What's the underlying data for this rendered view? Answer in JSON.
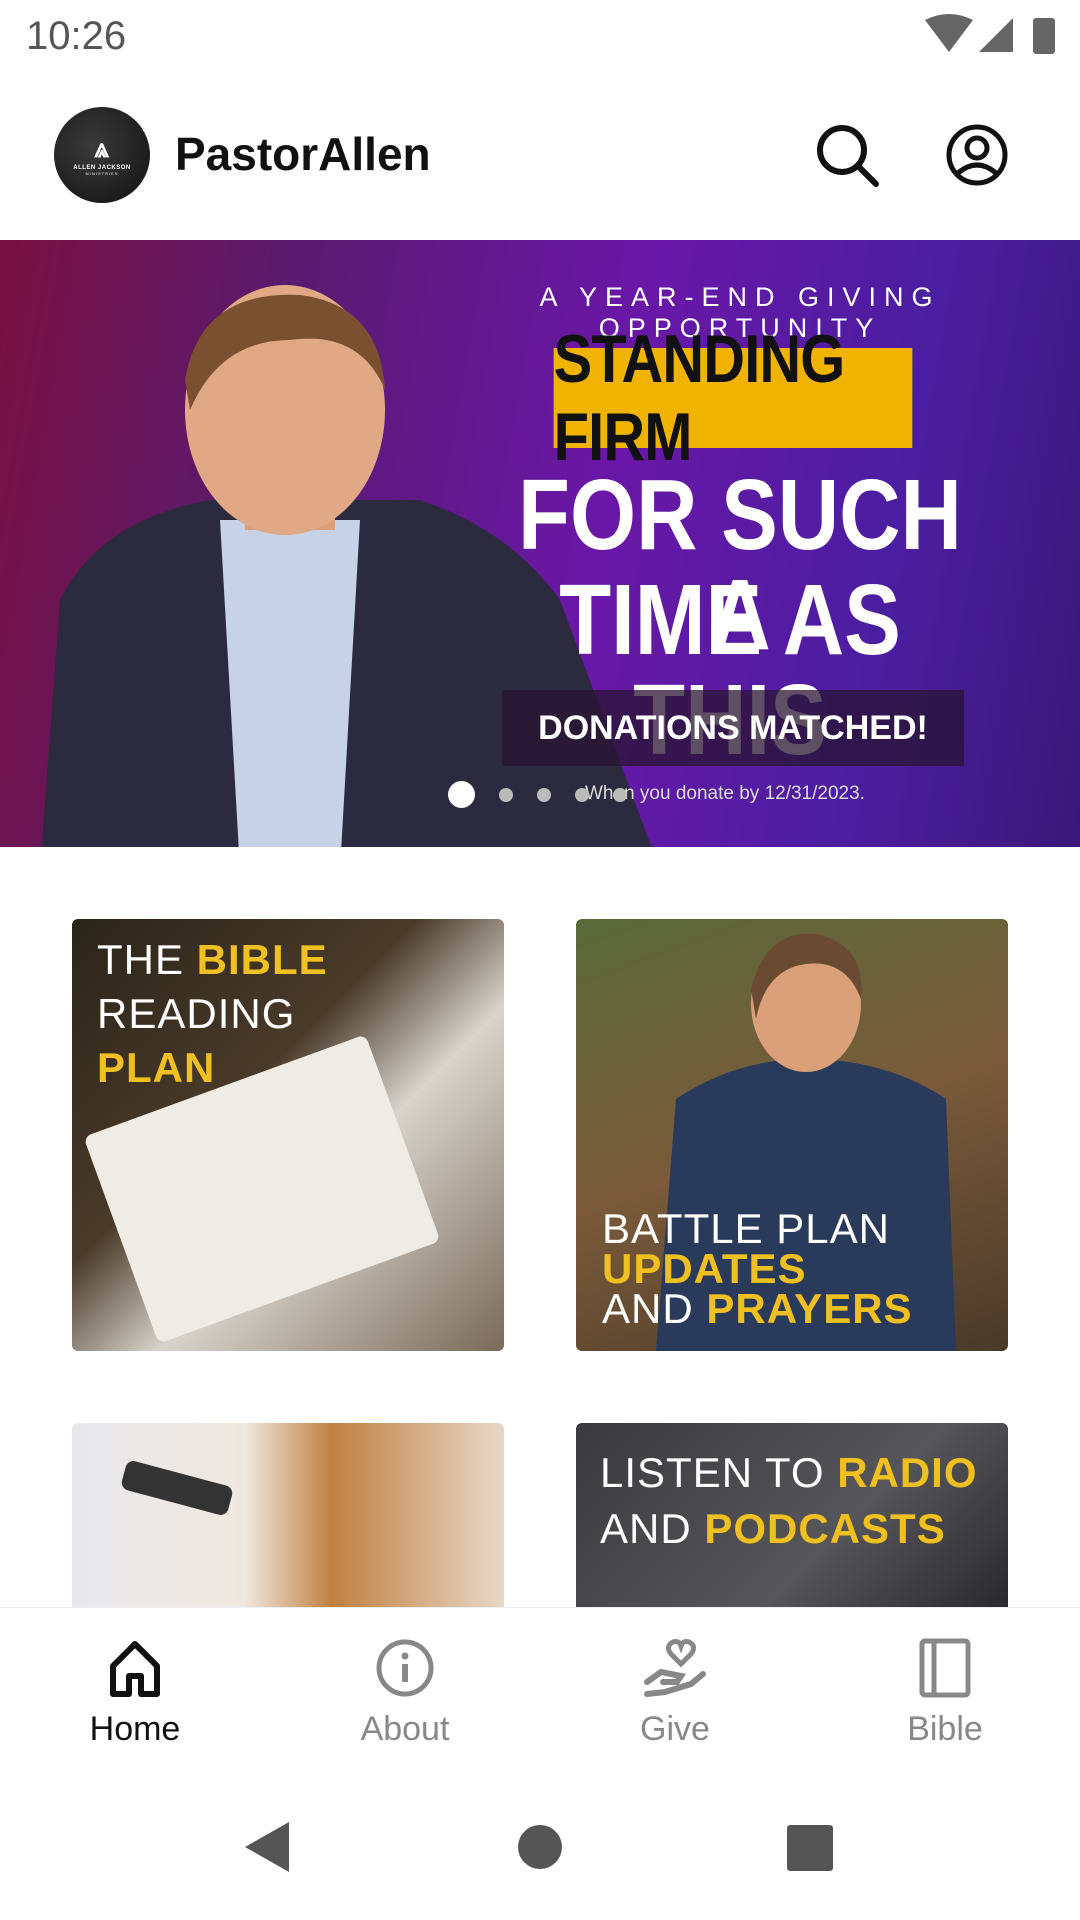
{
  "status_bar": {
    "time": "10:26"
  },
  "header": {
    "logo_text": "ALLEN JACKSON",
    "logo_subtext": "MINISTRIES",
    "title": "PastorAllen"
  },
  "banner": {
    "kicker": "A YEAR-END GIVING OPPORTUNITY",
    "highlight": "STANDING FIRM",
    "headline_1": "FOR SUCH A",
    "headline_2": "TIME AS THIS",
    "badge": "DONATIONS MATCHED!",
    "fine_print": "When you donate by 12/31/2023.",
    "slide_count": 5,
    "active_slide": 1
  },
  "tiles": [
    {
      "line1_a": "THE ",
      "line1_b": "BIBLE",
      "line2": "READING",
      "line3": "PLAN"
    },
    {
      "line1": "BATTLE PLAN",
      "line2": "UPDATES",
      "line3_a": "AND ",
      "line3_b": "PRAYERS"
    },
    {},
    {
      "line1_a": "LISTEN TO ",
      "line1_b": "RADIO",
      "line2_a": "AND ",
      "line2_b": "PODCASTS"
    }
  ],
  "bottom_nav": {
    "items": [
      {
        "label": "Home",
        "icon": "home-icon",
        "active": true
      },
      {
        "label": "About",
        "icon": "info-icon"
      },
      {
        "label": "Give",
        "icon": "give-heart-hand-icon"
      },
      {
        "label": "Bible",
        "icon": "book-icon"
      }
    ]
  },
  "colors": {
    "accent_yellow": "#f0b400",
    "banner_purple": "#6a17a8"
  }
}
